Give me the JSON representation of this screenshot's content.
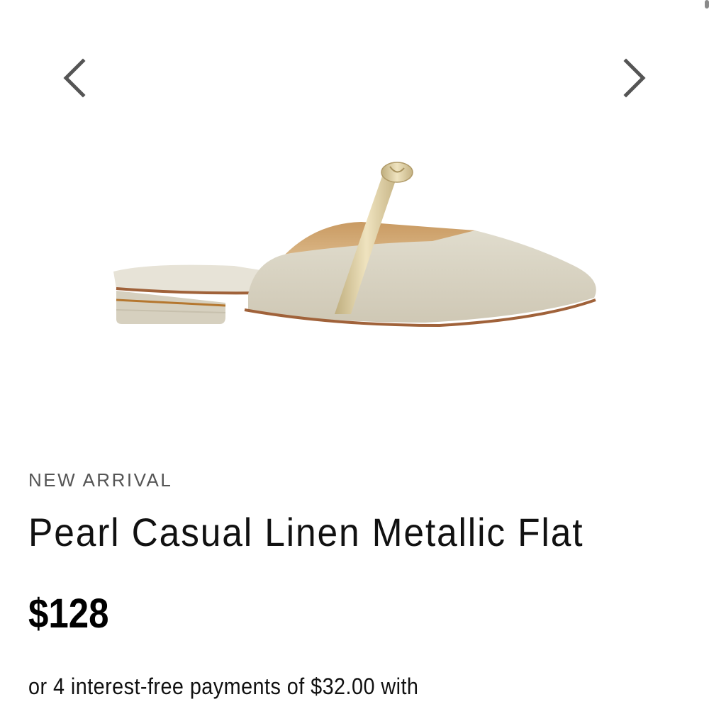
{
  "gallery": {
    "prev_icon": "chevron-left-icon",
    "next_icon": "chevron-right-icon",
    "image_alt": "Pearl Casual Linen Metallic Flat"
  },
  "product": {
    "badge": "NEW ARRIVAL",
    "title": "Pearl Casual Linen Metallic Flat",
    "price": "$128",
    "installments_text": "or 4 interest-free payments of $32.00 with"
  },
  "colors": {
    "text": "#111111",
    "badge_text": "#555555",
    "chevron": "#555555",
    "linen": "#d9d4c4",
    "metallic_strap": "#d8c79a",
    "sole": "#a0623a"
  }
}
